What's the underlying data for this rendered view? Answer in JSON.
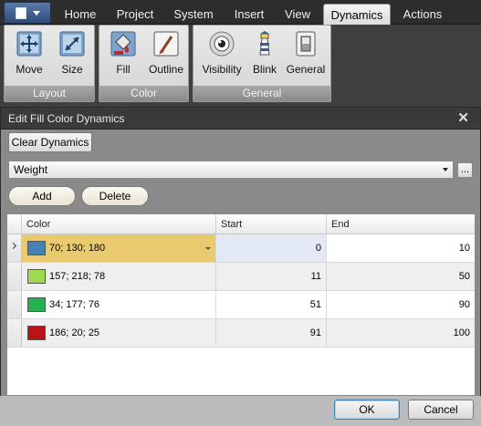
{
  "ribbon": {
    "tabs": [
      "Home",
      "Project",
      "System",
      "Insert",
      "View",
      "Dynamics",
      "Actions"
    ],
    "active_tab": "Dynamics",
    "groups": [
      {
        "caption": "Layout",
        "buttons": [
          "Move",
          "Size"
        ]
      },
      {
        "caption": "Color",
        "buttons": [
          "Fill",
          "Outline"
        ]
      },
      {
        "caption": "General",
        "buttons": [
          "Visibility",
          "Blink",
          "General"
        ]
      }
    ]
  },
  "dialog": {
    "title": "Edit Fill Color Dynamics",
    "close_glyph": "✕",
    "clear_label": "Clear Dynamics",
    "tag_value": "Weight",
    "ellipsis_label": "...",
    "add_label": "Add",
    "delete_label": "Delete",
    "ok_label": "OK",
    "cancel_label": "Cancel",
    "columns": [
      "Color",
      "Start",
      "End"
    ],
    "rows": [
      {
        "color": "70; 130; 180",
        "hex": "#4682b4",
        "start": "0",
        "end": "10",
        "selected": true
      },
      {
        "color": "157; 218; 78",
        "hex": "#9dda4e",
        "start": "11",
        "end": "50",
        "selected": false
      },
      {
        "color": "34; 177; 76",
        "hex": "#22b14c",
        "start": "51",
        "end": "90",
        "selected": false
      },
      {
        "color": "186; 20; 25",
        "hex": "#ba1419",
        "start": "91",
        "end": "100",
        "selected": false
      }
    ]
  },
  "colors": {
    "selected_row": "#eaca6e",
    "dialog_body": "#8a8a8a",
    "ribbon_caption": "#999999"
  }
}
